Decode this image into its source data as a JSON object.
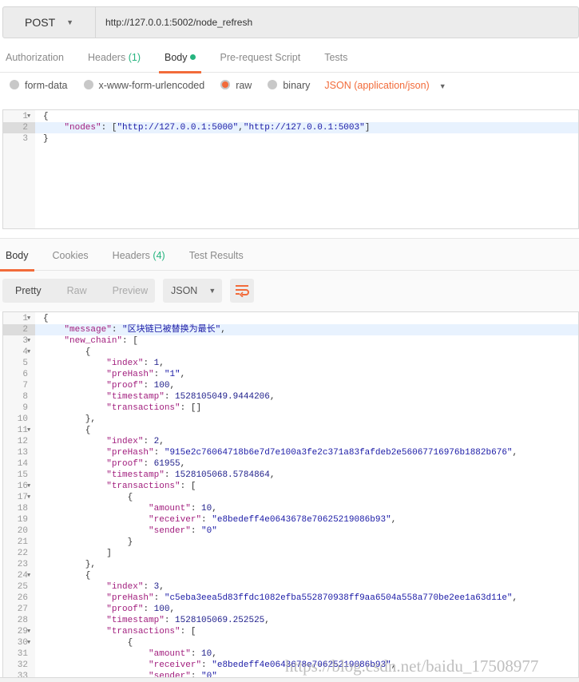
{
  "request": {
    "method": "POST",
    "url": "http://127.0.0.1:5002/node_refresh"
  },
  "request_tabs": [
    {
      "label": "Authorization"
    },
    {
      "label": "Headers",
      "count": "(1)"
    },
    {
      "label": "Body",
      "active": true,
      "dot": true
    },
    {
      "label": "Pre-request Script"
    },
    {
      "label": "Tests"
    }
  ],
  "body_types": [
    {
      "label": "form-data"
    },
    {
      "label": "x-www-form-urlencoded"
    },
    {
      "label": "raw",
      "selected": true
    },
    {
      "label": "binary"
    }
  ],
  "content_type": "JSON (application/json)",
  "request_body": [
    {
      "n": "1",
      "fold": true,
      "tokens": [
        [
          "p",
          "{"
        ]
      ]
    },
    {
      "n": "2",
      "hl": true,
      "tokens": [
        [
          "p",
          "    "
        ],
        [
          "k",
          "\"nodes\""
        ],
        [
          "p",
          ": ["
        ],
        [
          "s",
          "\"http://127.0.0.1:5000\""
        ],
        [
          "p",
          ","
        ],
        [
          "s",
          "\"http://127.0.0.1:5003\""
        ],
        [
          "p",
          "]"
        ]
      ]
    },
    {
      "n": "3",
      "tokens": [
        [
          "p",
          "}"
        ]
      ]
    }
  ],
  "response_tabs": [
    {
      "label": "Body",
      "active": true
    },
    {
      "label": "Cookies"
    },
    {
      "label": "Headers",
      "count": "(4)"
    },
    {
      "label": "Test Results"
    }
  ],
  "view_modes": [
    {
      "label": "Pretty",
      "active": true
    },
    {
      "label": "Raw"
    },
    {
      "label": "Preview"
    }
  ],
  "format": "JSON",
  "colors": {
    "accent": "#f26b3a",
    "green": "#26b47f",
    "key": "#a11d7d",
    "string": "#1a1aa6",
    "number": "#1d1d8a"
  },
  "response_body": [
    {
      "n": "1",
      "fold": true,
      "tokens": [
        [
          "p",
          "{"
        ]
      ]
    },
    {
      "n": "2",
      "hl": true,
      "tokens": [
        [
          "p",
          "    "
        ],
        [
          "k",
          "\"message\""
        ],
        [
          "p",
          ": "
        ],
        [
          "s",
          "\"区块链已被替换为最长\""
        ],
        [
          "p",
          ","
        ]
      ]
    },
    {
      "n": "3",
      "fold": true,
      "tokens": [
        [
          "p",
          "    "
        ],
        [
          "k",
          "\"new_chain\""
        ],
        [
          "p",
          ": ["
        ]
      ]
    },
    {
      "n": "4",
      "fold": true,
      "tokens": [
        [
          "p",
          "        {"
        ]
      ]
    },
    {
      "n": "5",
      "tokens": [
        [
          "p",
          "            "
        ],
        [
          "k",
          "\"index\""
        ],
        [
          "p",
          ": "
        ],
        [
          "n",
          "1"
        ],
        [
          "p",
          ","
        ]
      ]
    },
    {
      "n": "6",
      "tokens": [
        [
          "p",
          "            "
        ],
        [
          "k",
          "\"preHash\""
        ],
        [
          "p",
          ": "
        ],
        [
          "s",
          "\"1\""
        ],
        [
          "p",
          ","
        ]
      ]
    },
    {
      "n": "7",
      "tokens": [
        [
          "p",
          "            "
        ],
        [
          "k",
          "\"proof\""
        ],
        [
          "p",
          ": "
        ],
        [
          "n",
          "100"
        ],
        [
          "p",
          ","
        ]
      ]
    },
    {
      "n": "8",
      "tokens": [
        [
          "p",
          "            "
        ],
        [
          "k",
          "\"timestamp\""
        ],
        [
          "p",
          ": "
        ],
        [
          "n",
          "1528105049.9444206"
        ],
        [
          "p",
          ","
        ]
      ]
    },
    {
      "n": "9",
      "tokens": [
        [
          "p",
          "            "
        ],
        [
          "k",
          "\"transactions\""
        ],
        [
          "p",
          ": []"
        ]
      ]
    },
    {
      "n": "10",
      "tokens": [
        [
          "p",
          "        },"
        ]
      ]
    },
    {
      "n": "11",
      "fold": true,
      "tokens": [
        [
          "p",
          "        {"
        ]
      ]
    },
    {
      "n": "12",
      "tokens": [
        [
          "p",
          "            "
        ],
        [
          "k",
          "\"index\""
        ],
        [
          "p",
          ": "
        ],
        [
          "n",
          "2"
        ],
        [
          "p",
          ","
        ]
      ]
    },
    {
      "n": "13",
      "tokens": [
        [
          "p",
          "            "
        ],
        [
          "k",
          "\"preHash\""
        ],
        [
          "p",
          ": "
        ],
        [
          "s",
          "\"915e2c76064718b6e7d7e100a3fe2c371a83fafdeb2e56067716976b1882b676\""
        ],
        [
          "p",
          ","
        ]
      ]
    },
    {
      "n": "14",
      "tokens": [
        [
          "p",
          "            "
        ],
        [
          "k",
          "\"proof\""
        ],
        [
          "p",
          ": "
        ],
        [
          "n",
          "61955"
        ],
        [
          "p",
          ","
        ]
      ]
    },
    {
      "n": "15",
      "tokens": [
        [
          "p",
          "            "
        ],
        [
          "k",
          "\"timestamp\""
        ],
        [
          "p",
          ": "
        ],
        [
          "n",
          "1528105068.5784864"
        ],
        [
          "p",
          ","
        ]
      ]
    },
    {
      "n": "16",
      "fold": true,
      "tokens": [
        [
          "p",
          "            "
        ],
        [
          "k",
          "\"transactions\""
        ],
        [
          "p",
          ": ["
        ]
      ]
    },
    {
      "n": "17",
      "fold": true,
      "tokens": [
        [
          "p",
          "                {"
        ]
      ]
    },
    {
      "n": "18",
      "tokens": [
        [
          "p",
          "                    "
        ],
        [
          "k",
          "\"amount\""
        ],
        [
          "p",
          ": "
        ],
        [
          "n",
          "10"
        ],
        [
          "p",
          ","
        ]
      ]
    },
    {
      "n": "19",
      "tokens": [
        [
          "p",
          "                    "
        ],
        [
          "k",
          "\"receiver\""
        ],
        [
          "p",
          ": "
        ],
        [
          "s",
          "\"e8bedeff4e0643678e70625219086b93\""
        ],
        [
          "p",
          ","
        ]
      ]
    },
    {
      "n": "20",
      "tokens": [
        [
          "p",
          "                    "
        ],
        [
          "k",
          "\"sender\""
        ],
        [
          "p",
          ": "
        ],
        [
          "s",
          "\"0\""
        ]
      ]
    },
    {
      "n": "21",
      "tokens": [
        [
          "p",
          "                }"
        ]
      ]
    },
    {
      "n": "22",
      "tokens": [
        [
          "p",
          "            ]"
        ]
      ]
    },
    {
      "n": "23",
      "tokens": [
        [
          "p",
          "        },"
        ]
      ]
    },
    {
      "n": "24",
      "fold": true,
      "tokens": [
        [
          "p",
          "        {"
        ]
      ]
    },
    {
      "n": "25",
      "tokens": [
        [
          "p",
          "            "
        ],
        [
          "k",
          "\"index\""
        ],
        [
          "p",
          ": "
        ],
        [
          "n",
          "3"
        ],
        [
          "p",
          ","
        ]
      ]
    },
    {
      "n": "26",
      "tokens": [
        [
          "p",
          "            "
        ],
        [
          "k",
          "\"preHash\""
        ],
        [
          "p",
          ": "
        ],
        [
          "s",
          "\"c5eba3eea5d83ffdc1082efba552870938ff9aa6504a558a770be2ee1a63d11e\""
        ],
        [
          "p",
          ","
        ]
      ]
    },
    {
      "n": "27",
      "tokens": [
        [
          "p",
          "            "
        ],
        [
          "k",
          "\"proof\""
        ],
        [
          "p",
          ": "
        ],
        [
          "n",
          "100"
        ],
        [
          "p",
          ","
        ]
      ]
    },
    {
      "n": "28",
      "tokens": [
        [
          "p",
          "            "
        ],
        [
          "k",
          "\"timestamp\""
        ],
        [
          "p",
          ": "
        ],
        [
          "n",
          "1528105069.252525"
        ],
        [
          "p",
          ","
        ]
      ]
    },
    {
      "n": "29",
      "fold": true,
      "tokens": [
        [
          "p",
          "            "
        ],
        [
          "k",
          "\"transactions\""
        ],
        [
          "p",
          ": ["
        ]
      ]
    },
    {
      "n": "30",
      "fold": true,
      "tokens": [
        [
          "p",
          "                {"
        ]
      ]
    },
    {
      "n": "31",
      "tokens": [
        [
          "p",
          "                    "
        ],
        [
          "k",
          "\"amount\""
        ],
        [
          "p",
          ": "
        ],
        [
          "n",
          "10"
        ],
        [
          "p",
          ","
        ]
      ]
    },
    {
      "n": "32",
      "tokens": [
        [
          "p",
          "                    "
        ],
        [
          "k",
          "\"receiver\""
        ],
        [
          "p",
          ": "
        ],
        [
          "s",
          "\"e8bedeff4e0643678e70625219086b93\""
        ],
        [
          "p",
          ","
        ]
      ]
    },
    {
      "n": "33",
      "tokens": [
        [
          "p",
          "                    "
        ],
        [
          "k",
          "\"sender\""
        ],
        [
          "p",
          ": "
        ],
        [
          "s",
          "\"0\""
        ]
      ]
    }
  ],
  "watermark": "https://blog.csdn.net/baidu_17508977"
}
